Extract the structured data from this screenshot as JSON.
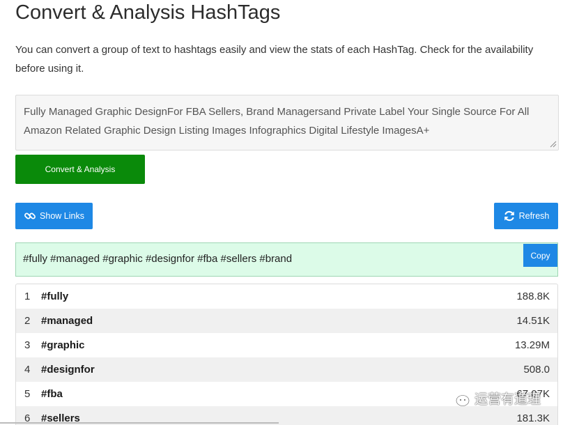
{
  "page": {
    "title": "Convert & Analysis HashTags",
    "description": "You can convert a group of text to hashtags easily and view the stats of each HashTag. Check for the availability before using it."
  },
  "input": {
    "value": "Fully Managed Graphic DesignFor FBA Sellers, Brand Managersand Private Label Your Single Source For All Amazon Related Graphic Design Listing Images Infographics Digital Lifestyle ImagesA+"
  },
  "buttons": {
    "convert": "Convert & Analysis",
    "show_links": "Show Links",
    "refresh": "Refresh",
    "copy": "Copy"
  },
  "result": {
    "hashtags": "#fully #managed #graphic #designfor #fba #sellers #brand"
  },
  "stats": {
    "rows": [
      {
        "rank": "1",
        "tag": "#fully",
        "count": "188.8K"
      },
      {
        "rank": "2",
        "tag": "#managed",
        "count": "14.51K"
      },
      {
        "rank": "3",
        "tag": "#graphic",
        "count": "13.29M"
      },
      {
        "rank": "4",
        "tag": "#designfor",
        "count": "508.0"
      },
      {
        "rank": "5",
        "tag": "#fba",
        "count": "67.07K"
      },
      {
        "rank": "6",
        "tag": "#sellers",
        "count": "181.3K"
      }
    ]
  },
  "watermark": {
    "text": "运营有道理",
    "icon": "wechat-icon"
  },
  "colors": {
    "convert_button": "#0a8a0a",
    "blue_button": "#1e88e5",
    "result_background": "#dcfbe8"
  }
}
